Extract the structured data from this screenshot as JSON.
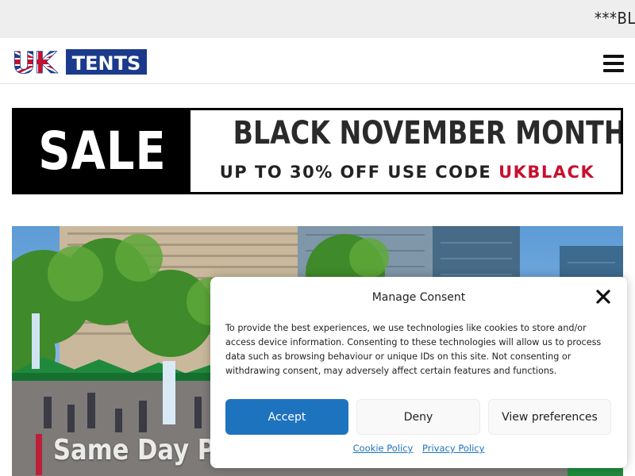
{
  "announcement": {
    "text": "***BLACK NOVEMBER MONTH***"
  },
  "header": {
    "logo": {
      "uk": "UK",
      "tents": "TENTS"
    },
    "menu_icon": "hamburger-menu-icon"
  },
  "sale_banner": {
    "left_text": "SALE",
    "headline": "BLACK NOVEMBER MONTH",
    "sub_prefix": "UP TO 30% OFF USE CODE",
    "code": "UKBLACK",
    "code_color": "#c8102e"
  },
  "hero": {
    "caption": "Same Day Pi"
  },
  "consent": {
    "title": "Manage Consent",
    "body": "To provide the best experiences, we use technologies like cookies to store and/or access device information. Consenting to these technologies will allow us to process data such as browsing behaviour or unique IDs on this site. Not consenting or withdrawing consent, may adversely affect certain features and functions.",
    "accept_label": "Accept",
    "deny_label": "Deny",
    "preferences_label": "View preferences",
    "cookie_policy_label": "Cookie Policy",
    "privacy_policy_label": "Privacy Policy",
    "accent_color": "#1e73be"
  }
}
